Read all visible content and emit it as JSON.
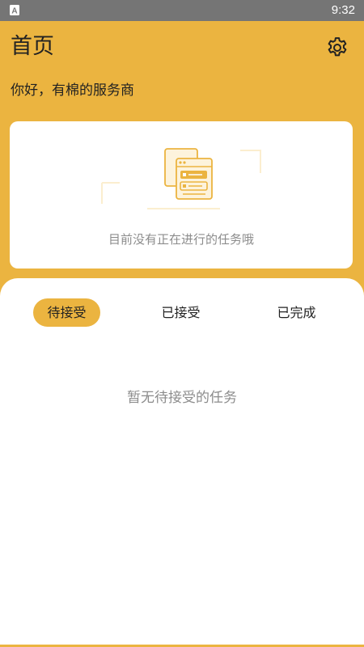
{
  "status_bar": {
    "time": "9:32",
    "app_icon_glyph": "A",
    "background_color": "#757575"
  },
  "header": {
    "title": "首页",
    "greeting": "你好，有棉的服务商",
    "settings_icon": "gear-icon",
    "background_color": "#EBB440"
  },
  "current_task_card": {
    "illustration_icon": "documents-illustration-icon",
    "empty_message": "目前没有正在进行的任务哦"
  },
  "task_tabs": {
    "active_tab": "待接受",
    "items": [
      {
        "label": "待接受",
        "active": true
      },
      {
        "label": "已接受",
        "active": false
      },
      {
        "label": "已完成",
        "active": false
      }
    ],
    "empty_message": "暂无待接受的任务"
  },
  "colors": {
    "accent": "#EBB440",
    "muted_text": "#8c8c8c",
    "primary_text": "#222222"
  }
}
